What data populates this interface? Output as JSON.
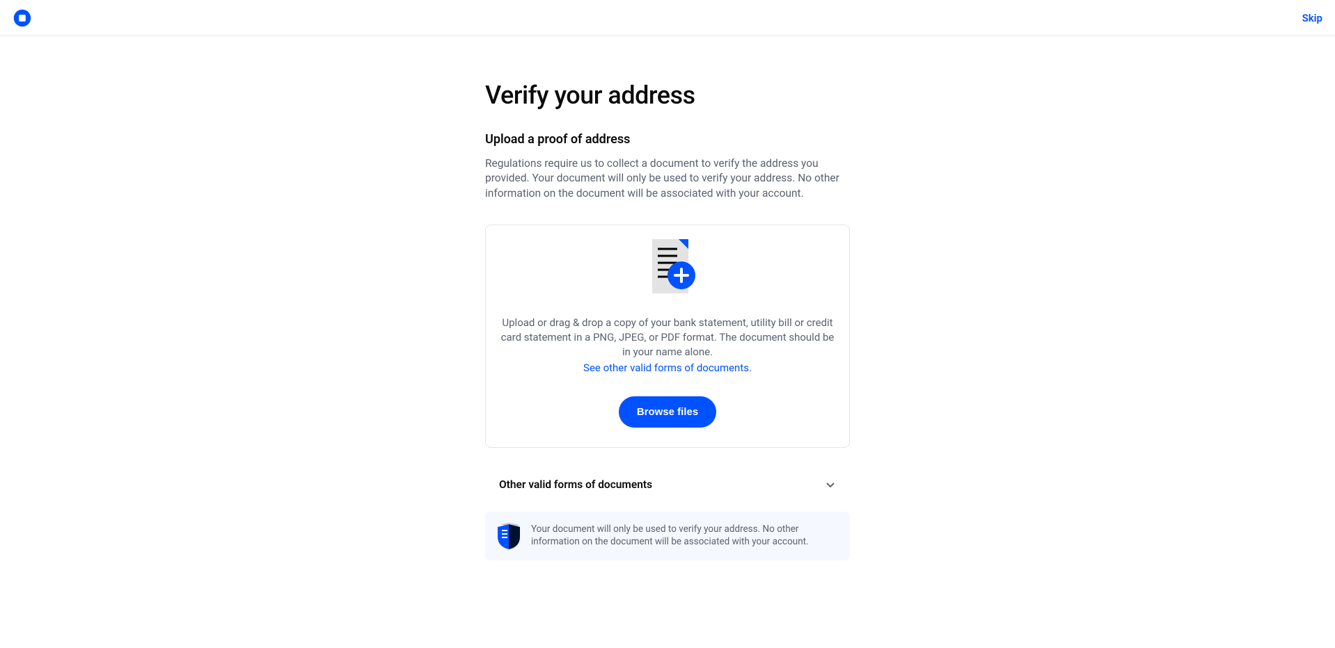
{
  "header": {
    "skip_label": "Skip"
  },
  "page": {
    "title": "Verify your address",
    "subtitle": "Upload a proof of address",
    "description": "Regulations require us to collect a document to verify the address you provided. Your document will only be used to verify your address. No other information on the document will be associated with your account."
  },
  "upload": {
    "instructions": "Upload or drag & drop a copy of your bank statement, utility bill or credit card statement in a PNG, JPEG, or PDF format. The document should be in your name alone.",
    "other_forms_link": "See other valid forms of documents.",
    "browse_button": "Browse files"
  },
  "accordion": {
    "label": "Other valid forms of documents"
  },
  "notice": {
    "text": "Your document will only be used to verify your address. No other information on the document will be associated with your account."
  }
}
